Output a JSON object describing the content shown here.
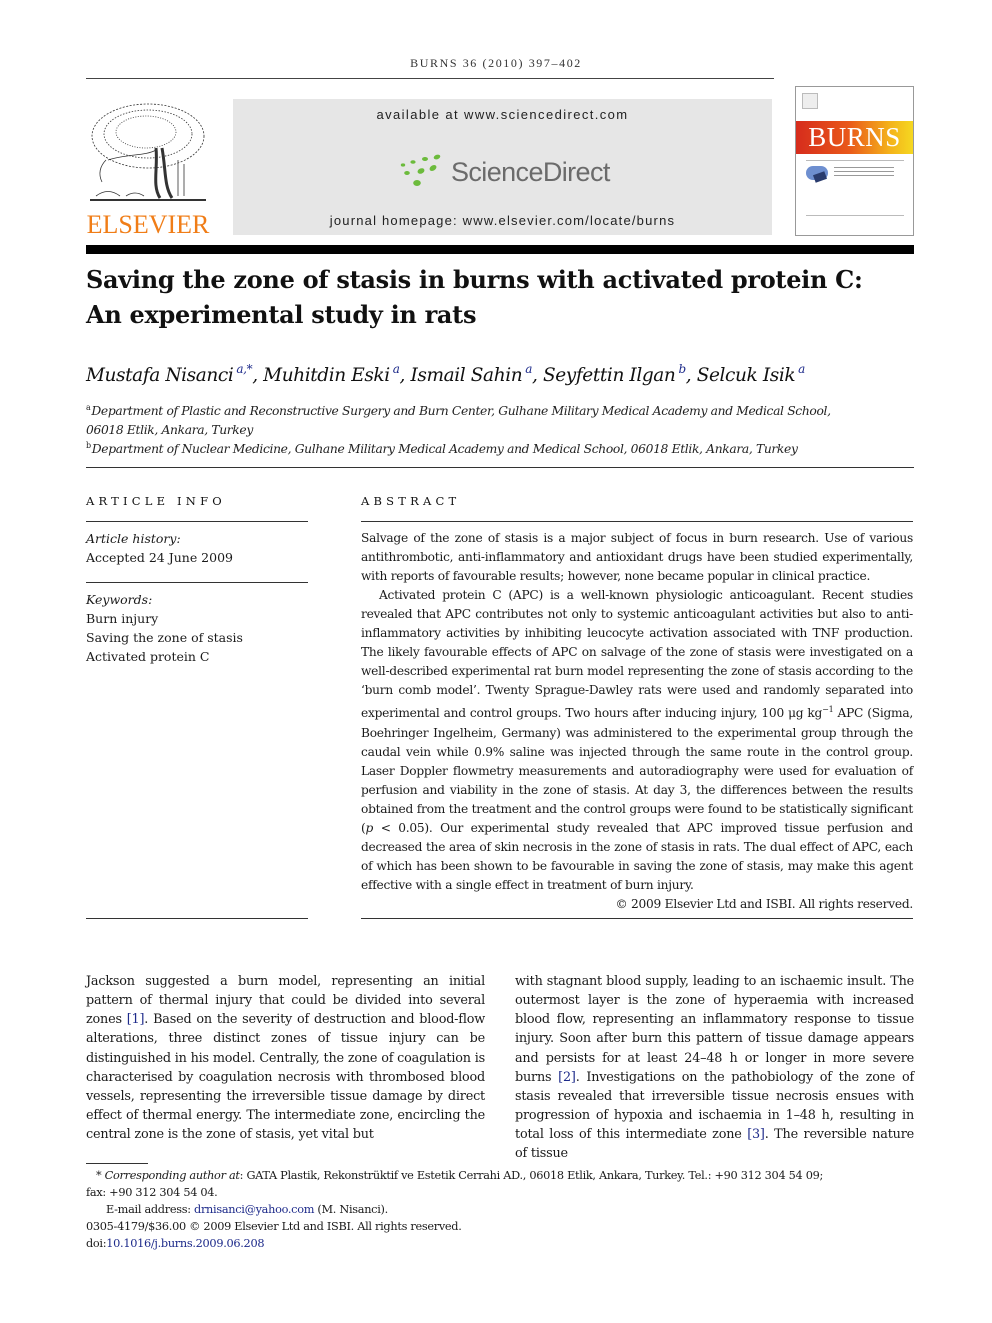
{
  "header": {
    "running_head": "BURNS 36 (2010) 397–402",
    "publisher_logo_text": "ELSEVIER",
    "available_at": "available at www.sciencedirect.com",
    "platform_logo_text": "ScienceDirect",
    "journal_homepage": "journal homepage: www.elsevier.com/locate/burns",
    "cover_title": "BURNS",
    "colors": {
      "publisher_orange": "#f07d17",
      "sciencedirect_green": "#6cbb3c",
      "link_blue": "#1d2a8a"
    }
  },
  "article": {
    "title_line1": "Saving the zone of stasis in burns with activated protein C:",
    "title_line2": "An experimental study in rats",
    "authors": [
      {
        "name": "Mustafa Nisanci",
        "sup": "a,*"
      },
      {
        "name": "Muhitdin Eski",
        "sup": "a"
      },
      {
        "name": "Ismail Sahin",
        "sup": "a"
      },
      {
        "name": "Seyfettin Ilgan",
        "sup": "b"
      },
      {
        "name": "Selcuk Isik",
        "sup": "a"
      }
    ],
    "affiliations": [
      {
        "mark": "a",
        "line1": "Department of Plastic and Reconstructive Surgery and Burn Center, Gulhane Military Medical Academy and Medical School,",
        "line2": "06018 Etlik, Ankara, Turkey"
      },
      {
        "mark": "b",
        "line1": "Department of Nuclear Medicine, Gulhane Military Medical Academy and Medical School, 06018 Etlik, Ankara, Turkey"
      }
    ]
  },
  "article_info": {
    "heading": "ARTICLE INFO",
    "history_label": "Article history:",
    "accepted": "Accepted 24 June 2009",
    "keywords_label": "Keywords:",
    "keywords": [
      "Burn injury",
      "Saving the zone of stasis",
      "Activated protein C"
    ]
  },
  "abstract": {
    "heading": "ABSTRACT",
    "p1": "Salvage of the zone of stasis is a major subject of focus in burn research. Use of various antithrombotic, anti-inflammatory and antioxidant drugs have been studied experimentally, with reports of favourable results; however, none became popular in clinical practice.",
    "p2a": "Activated protein C (APC) is a well-known physiologic anticoagulant. Recent studies revealed that APC contributes not only to systemic anticoagulant activities but also to anti-inflammatory activities by inhibiting leucocyte activation associated with TNF production. The likely favourable effects of APC on salvage of the zone of stasis were investigated on a well-described experimental rat burn model representing the zone of stasis according to the ‘burn comb model’. Twenty Sprague-Dawley rats were used and randomly separated into experimental and control groups. Two hours after inducing injury, 100 μg kg",
    "p2_sup": "−1",
    "p2b": " APC (Sigma, Boehringer Ingelheim, Germany) was administered to the experimental group through the caudal vein while 0.9% saline was injected through the same route in the control group. Laser Doppler flowmetry measurements and autoradiography were used for evaluation of perfusion and viability in the zone of stasis. At day 3, the differences between the results obtained from the treatment and the control groups were found to be statistically significant (",
    "p2_p": "p",
    "p2c": " < 0.05). Our experimental study revealed that APC improved tissue perfusion and decreased the area of skin necrosis in the zone of stasis in rats. The dual effect of APC, each of which has been shown to be favourable in saving the zone of stasis, may make this agent effective with a single effect in treatment of burn injury.",
    "copyright": "© 2009 Elsevier Ltd and ISBI. All rights reserved."
  },
  "body": {
    "left_a": "Jackson suggested a burn model, representing an initial pattern of thermal injury that could be divided into several zones ",
    "ref1": "[1]",
    "left_b": ". Based on the severity of destruction and blood-flow alterations, three distinct zones of tissue injury can be distinguished in his model. Centrally, the zone of coagulation is characterised by coagulation necrosis with thrombosed blood vessels, representing the irreversible tissue damage by direct effect of thermal energy. The intermediate zone, encircling the central zone is the zone of stasis, yet vital but",
    "right_a": "with stagnant blood supply, leading to an ischaemic insult. The outermost layer is the zone of hyperaemia with increased blood flow, representing an inflammatory response to tissue injury. Soon after burn this pattern of tissue damage appears and persists for at least 24–48 h or longer in more severe burns ",
    "ref2": "[2]",
    "right_b": ". Investigations on the pathobiology of the zone of stasis revealed that irreversible tissue necrosis ensues with progression of hypoxia and ischaemia in 1–48 h, resulting in total loss of this intermediate zone ",
    "ref3": "[3]",
    "right_c": ". The reversible nature of tissue"
  },
  "footnotes": {
    "star": "*",
    "corr_label": "Corresponding author at",
    "corr_text": ": GATA Plastik, Rekonstrüktif ve Estetik Cerrahi AD., 06018 Etlik, Ankara, Turkey. Tel.: +90 312 304 54 09;",
    "fax": "fax: +90 312 304 54 04.",
    "email_label": "E-mail address: ",
    "email": "drnisanci@yahoo.com",
    "email_suffix": " (M. Nisanci).",
    "issn": "0305-4179/$36.00 © 2009 Elsevier Ltd and ISBI. All rights reserved.",
    "doi_label": "doi:",
    "doi": "10.1016/j.burns.2009.06.208"
  }
}
